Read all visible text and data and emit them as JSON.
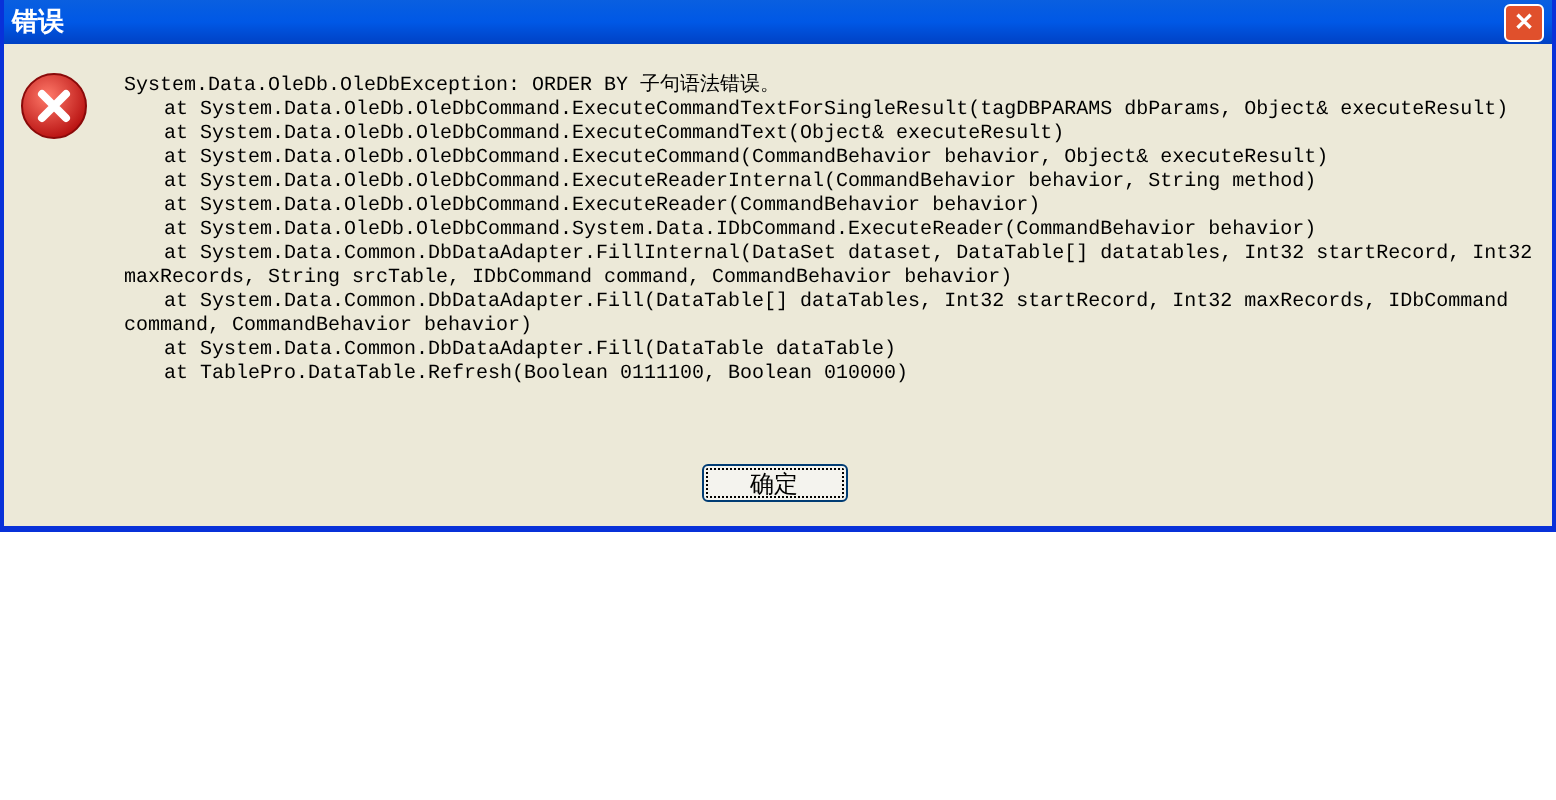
{
  "window": {
    "title": "错误",
    "close": "✕"
  },
  "message_lines": [
    {
      "text": "System.Data.OleDb.OleDbException: ORDER BY 子句语法错误。",
      "indented": false
    },
    {
      "text": "at System.Data.OleDb.OleDbCommand.ExecuteCommandTextForSingleResult(tagDBPARAMS dbParams, Object& executeResult)",
      "indented": true
    },
    {
      "text": "at System.Data.OleDb.OleDbCommand.ExecuteCommandText(Object& executeResult)",
      "indented": true
    },
    {
      "text": "at System.Data.OleDb.OleDbCommand.ExecuteCommand(CommandBehavior behavior, Object& executeResult)",
      "indented": true
    },
    {
      "text": "at System.Data.OleDb.OleDbCommand.ExecuteReaderInternal(CommandBehavior behavior, String method)",
      "indented": true
    },
    {
      "text": "at System.Data.OleDb.OleDbCommand.ExecuteReader(CommandBehavior behavior)",
      "indented": true
    },
    {
      "text": "at System.Data.OleDb.OleDbCommand.System.Data.IDbCommand.ExecuteReader(CommandBehavior behavior)",
      "indented": true
    },
    {
      "text": "at System.Data.Common.DbDataAdapter.FillInternal(DataSet dataset, DataTable[] datatables, Int32 startRecord, Int32",
      "indented": true
    },
    {
      "text": "maxRecords, String srcTable, IDbCommand command, CommandBehavior behavior)",
      "indented": false
    },
    {
      "text": "at System.Data.Common.DbDataAdapter.Fill(DataTable[] dataTables, Int32 startRecord, Int32 maxRecords, IDbCommand",
      "indented": true
    },
    {
      "text": "command, CommandBehavior behavior)",
      "indented": false
    },
    {
      "text": "at System.Data.Common.DbDataAdapter.Fill(DataTable dataTable)",
      "indented": true
    },
    {
      "text": "at TablePro.DataTable.Refresh(Boolean 0111100, Boolean 010000)",
      "indented": true
    }
  ],
  "buttons": [
    "确定"
  ]
}
